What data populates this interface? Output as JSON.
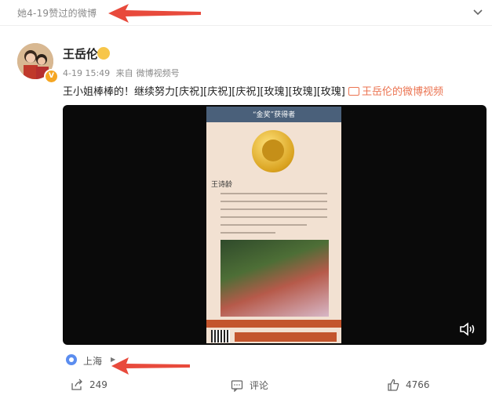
{
  "header": {
    "label": "她4-19赞过的微博",
    "chevron_icon": "chevron-down-icon"
  },
  "post": {
    "username": "王岳伦",
    "date": "4-19 15:49",
    "source_prefix": "来自",
    "source": "微博视频号",
    "text": "王小姐棒棒的！继续努力[庆祝][庆祝][庆祝][玫瑰][玫瑰][玫瑰]",
    "video_link": "王岳伦的微博视频"
  },
  "video": {
    "poster_title": "“金奖”获得者",
    "poster_name": "王诗龄",
    "mute_icon": "speaker-icon"
  },
  "location": {
    "label": "上海",
    "icon": "location-pin-icon"
  },
  "actions": {
    "share_count": "249",
    "comment_label": "评论",
    "like_count": "4766"
  },
  "colors": {
    "accent": "#eb7350",
    "arrow": "#e84a3c",
    "location": "#5b8def"
  }
}
